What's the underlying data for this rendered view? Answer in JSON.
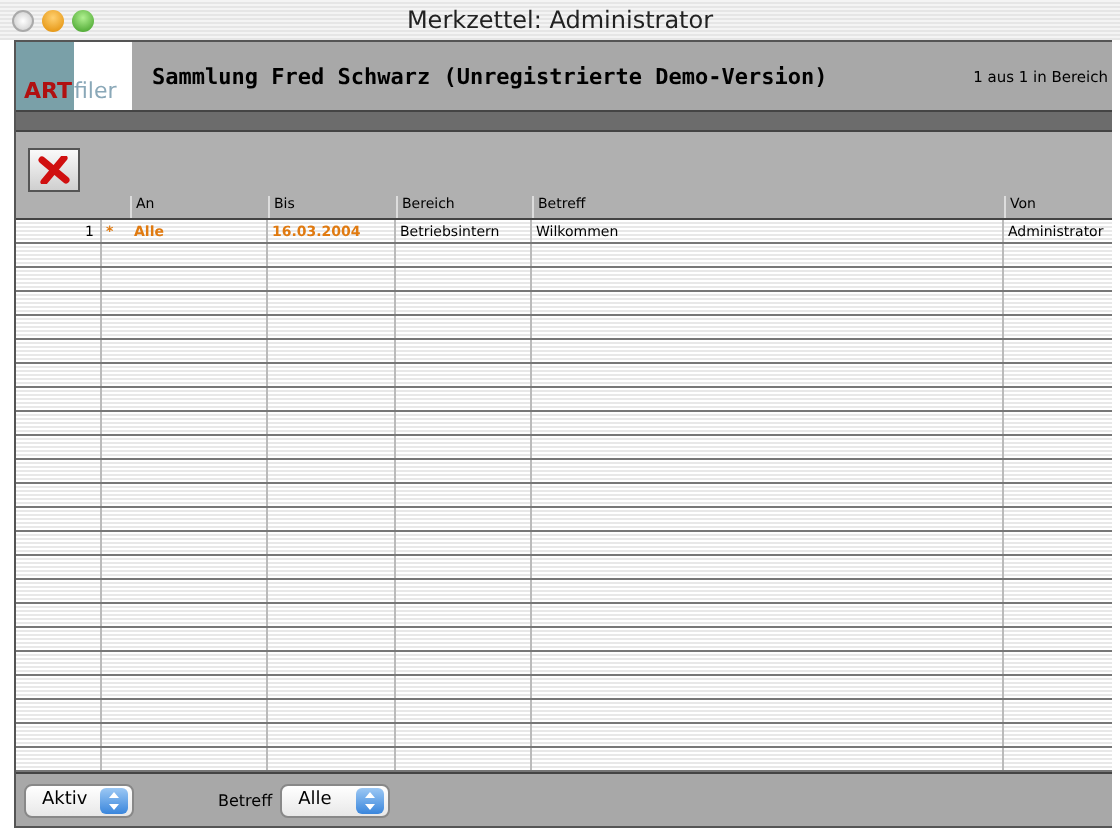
{
  "window": {
    "title": "Merkzettel: Administrator"
  },
  "header": {
    "logo_bold": "ART",
    "logo_light": "filer",
    "title": "Sammlung Fred Schwarz (Unregistrierte Demo-Version)",
    "record_count": "1 aus 1 in Bereich"
  },
  "table": {
    "columns": [
      "An",
      "Bis",
      "Bereich",
      "Betreff",
      "Von"
    ],
    "rows": [
      {
        "number": "1",
        "flag": "*",
        "an": "Alle",
        "bis": "16.03.2004",
        "bereich": "Betriebsintern",
        "betreff": "Wilkommen",
        "von": "Administrator"
      }
    ]
  },
  "footer": {
    "status_popup": "Aktiv",
    "filter_label": "Betreff",
    "filter_popup": "Alle"
  }
}
